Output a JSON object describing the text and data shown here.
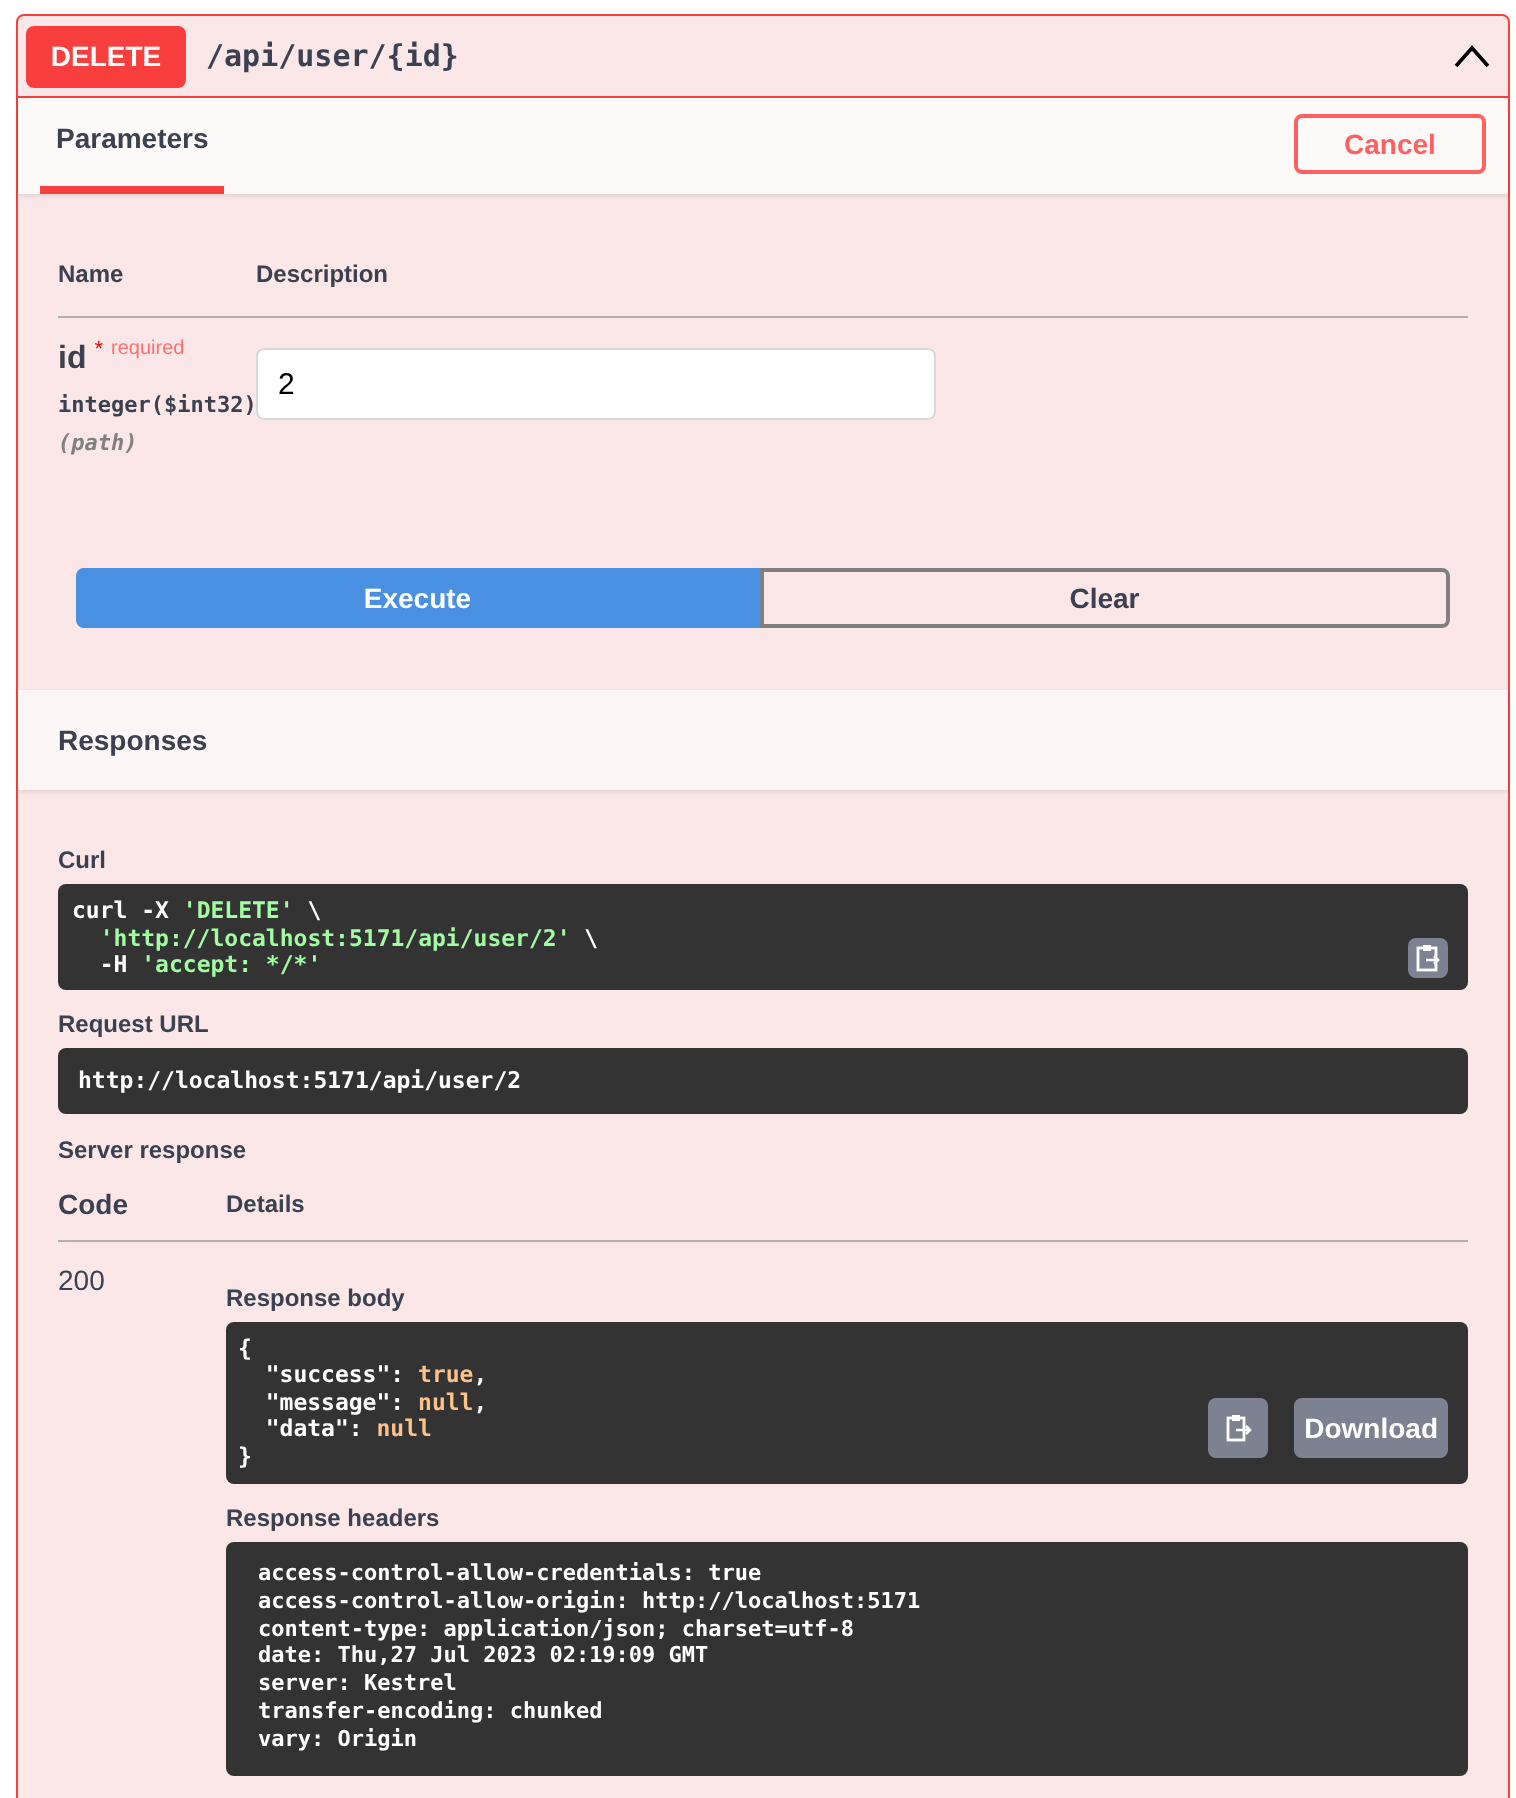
{
  "operation": {
    "method": "DELETE",
    "path": "/api/user/{id}",
    "expanded": true
  },
  "tabs": [
    {
      "label": "Parameters",
      "selected": true
    }
  ],
  "cancel_button": "Cancel",
  "parameters_table": {
    "columns": [
      "Name",
      "Description"
    ],
    "rows": [
      {
        "name": "id",
        "required_mark": "*",
        "required_label": "required",
        "type": "integer($int32)",
        "location": "(path)",
        "value": "2"
      }
    ]
  },
  "actions": [
    {
      "label": "Execute",
      "kind": "primary"
    },
    {
      "label": "Clear",
      "kind": "secondary"
    }
  ],
  "responses_title": "Responses",
  "curl": {
    "label": "Curl",
    "lines": [
      [
        {
          "text": "curl -X ",
          "kind": "plain"
        },
        {
          "text": "'DELETE'",
          "kind": "string"
        },
        {
          "text": " \\",
          "kind": "plain"
        }
      ],
      [
        {
          "text": "  'http://localhost:5171/api/user/2'",
          "kind": "string"
        },
        {
          "text": " \\",
          "kind": "plain"
        }
      ],
      [
        {
          "text": "  -H ",
          "kind": "plain"
        },
        {
          "text": "'accept: */*'",
          "kind": "string"
        }
      ]
    ]
  },
  "request_url": {
    "label": "Request URL",
    "value": "http://localhost:5171/api/user/2"
  },
  "server_response": {
    "label": "Server response",
    "columns": [
      "Code",
      "Details"
    ],
    "code": "200",
    "body_label": "Response body",
    "body_lines": [
      [
        {
          "text": "{",
          "kind": "plain"
        }
      ],
      [
        {
          "text": "  \"success\": ",
          "kind": "plain"
        },
        {
          "text": "true",
          "kind": "literal"
        },
        {
          "text": ",",
          "kind": "plain"
        }
      ],
      [
        {
          "text": "  \"message\": ",
          "kind": "plain"
        },
        {
          "text": "null",
          "kind": "literal"
        },
        {
          "text": ",",
          "kind": "plain"
        }
      ],
      [
        {
          "text": "  \"data\": ",
          "kind": "plain"
        },
        {
          "text": "null",
          "kind": "literal"
        }
      ],
      [
        {
          "text": "}",
          "kind": "plain"
        }
      ]
    ],
    "download_button": "Download",
    "headers_label": "Response headers",
    "headers": [
      "access-control-allow-credentials: true",
      "access-control-allow-origin: http://localhost:5171",
      "content-type: application/json; charset=utf-8",
      "date: Thu,27 Jul 2023 02:19:09 GMT",
      "server: Kestrel",
      "transfer-encoding: chunked",
      "vary: Origin"
    ]
  }
}
